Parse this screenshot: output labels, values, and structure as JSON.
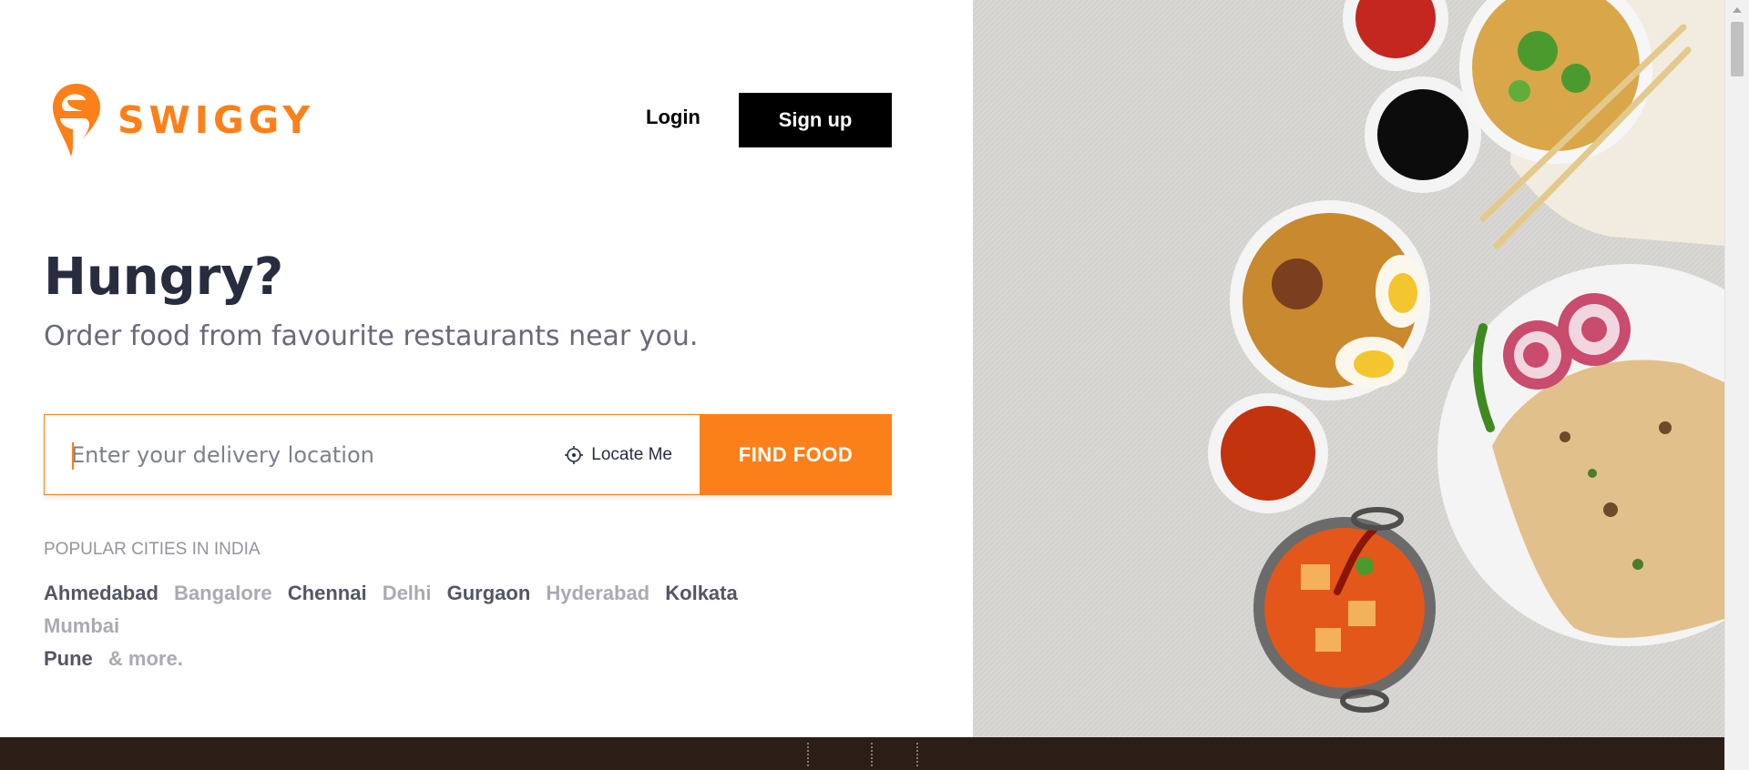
{
  "brand": {
    "name": "SWIGGY",
    "color": "#fc8019",
    "logo_icon": "swiggy-pin-icon"
  },
  "header": {
    "login_label": "Login",
    "signup_label": "Sign up"
  },
  "hero": {
    "title": "Hungry?",
    "subtitle": "Order food from favourite restaurants near you."
  },
  "search": {
    "placeholder": "Enter your delivery location",
    "value": "",
    "locate_label": "Locate Me",
    "locate_icon": "crosshair-icon",
    "button_label": "FIND FOOD"
  },
  "cities": {
    "title": "POPULAR CITIES IN INDIA",
    "items": [
      {
        "label": "Ahmedabad",
        "tone": "dark"
      },
      {
        "label": "Bangalore",
        "tone": "light"
      },
      {
        "label": "Chennai",
        "tone": "dark"
      },
      {
        "label": "Delhi",
        "tone": "light"
      },
      {
        "label": "Gurgaon",
        "tone": "dark"
      },
      {
        "label": "Hyderabad",
        "tone": "light"
      },
      {
        "label": "Kolkata",
        "tone": "dark"
      },
      {
        "label": "Mumbai",
        "tone": "light"
      },
      {
        "label": "Pune",
        "tone": "dark"
      }
    ],
    "more_label": "& more."
  },
  "hero_image": {
    "icon": "food-platter-image"
  },
  "colors": {
    "accent": "#fc8019",
    "dark_text": "#282c3f",
    "footer": "#2b1e16"
  }
}
